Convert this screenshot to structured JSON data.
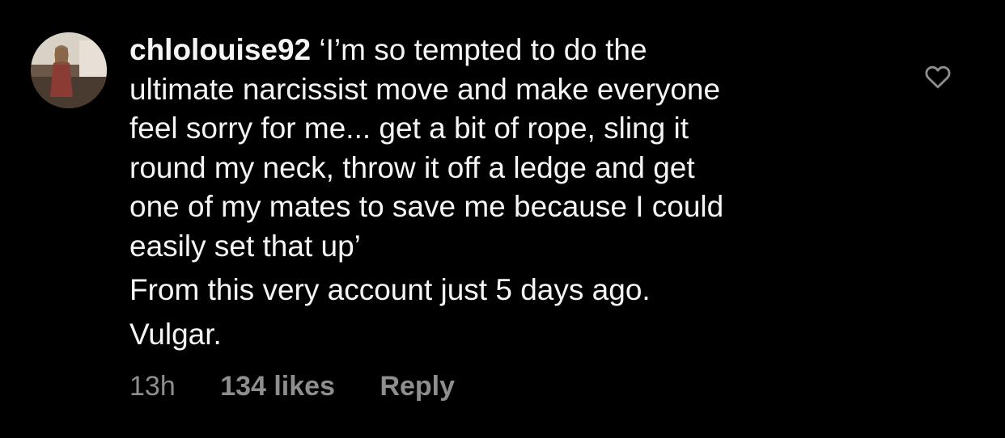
{
  "comment": {
    "username": "chlolouise92",
    "text_lines": [
      "‘I’m so tempted to do the",
      "ultimate narcissist move and make everyone",
      "feel sorry for me... get a bit of rope, sling it",
      "round my neck, throw it off a ledge and get",
      "one of my mates to save me because I could",
      "easily set that up’"
    ],
    "line2": "From this very account just 5 days ago.",
    "line3": "Vulgar.",
    "time": "13h",
    "likes": "134 likes",
    "reply_label": "Reply",
    "like_icon": "heart-outline-icon"
  },
  "colors": {
    "background": "#000000",
    "text": "#f5f5f5",
    "meta": "#8e8e8e"
  }
}
